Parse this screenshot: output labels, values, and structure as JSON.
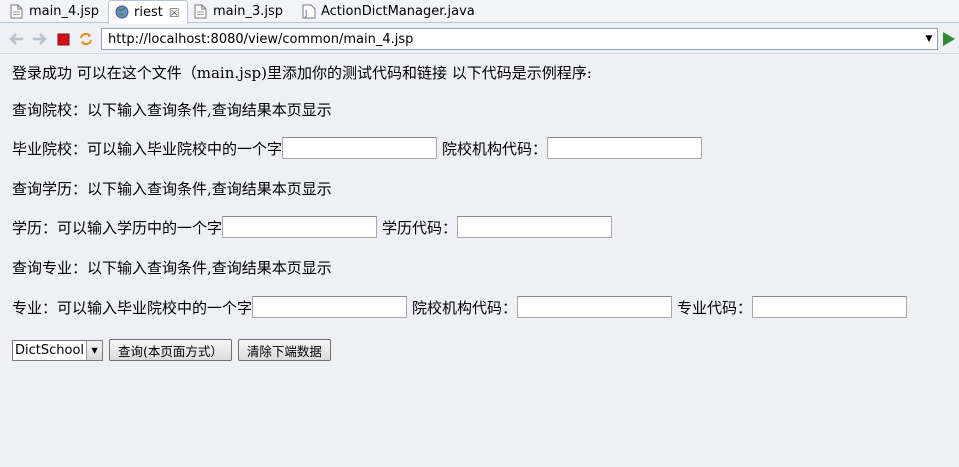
{
  "tabs": [
    {
      "label": "main_4.jsp",
      "icon": "jsp-file-icon"
    },
    {
      "label": "riest",
      "icon": "globe-icon",
      "active": true,
      "close": "☒"
    },
    {
      "label": "main_3.jsp",
      "icon": "jsp-file-icon"
    },
    {
      "label": "ActionDictManager.java",
      "icon": "java-file-icon"
    }
  ],
  "toolbar": {
    "url": "http://localhost:8080/view/common/main_4.jsp"
  },
  "page": {
    "intro": "登录成功 可以在这个文件（main.jsp)里添加你的测试代码和链接 以下代码是示例程序:",
    "school_heading": "查询院校：以下输入查询条件,查询结果本页显示",
    "school_label": "毕业院校：可以输入毕业院校中的一个字",
    "school_code_label": "院校机构代码：",
    "edu_heading": "查询学历：以下输入查询条件,查询结果本页显示",
    "edu_label": "学历：可以输入学历中的一个字",
    "edu_code_label": "学历代码：",
    "major_heading": "查询专业：以下输入查询条件,查询结果本页显示",
    "major_label": "专业：可以输入毕业院校中的一个字",
    "major_school_code_label": "院校机构代码：",
    "major_code_label": "专业代码：",
    "select_value": "DictSchool",
    "query_button": "查询(本页面方式）",
    "clear_button": "清除下端数据"
  },
  "colors": {
    "page_bg": "#eef0f5",
    "go_arrow": "#2e8b2e",
    "stop": "#d01010"
  }
}
